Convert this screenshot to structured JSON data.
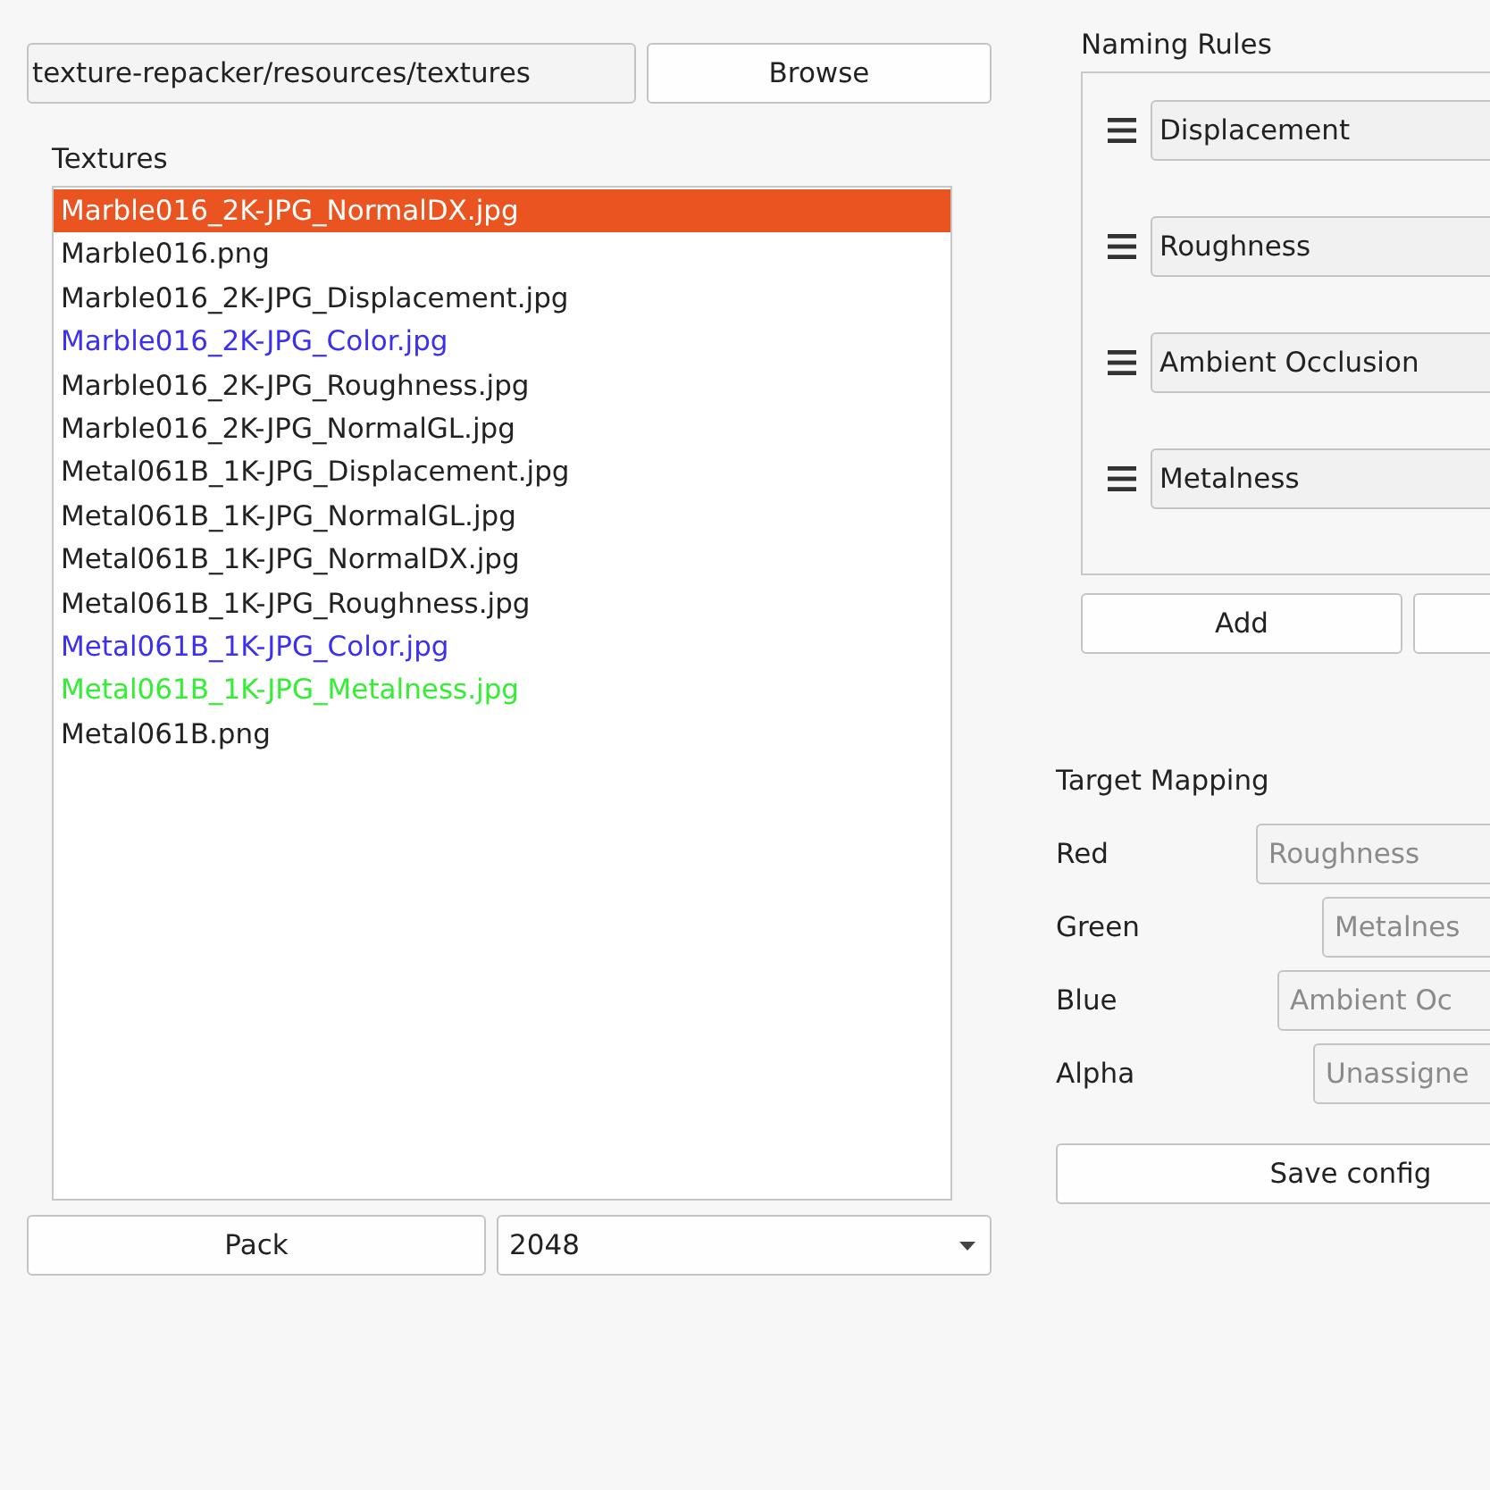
{
  "path_field": {
    "value": "texture-repacker/resources/textures"
  },
  "browse_button": "Browse",
  "textures": {
    "label": "Textures",
    "items": [
      {
        "name": "Marble016_2K-JPG_NormalDX.jpg",
        "selected": true
      },
      {
        "name": "Marble016.png",
        "selected": false,
        "color": "#222222"
      },
      {
        "name": "Marble016_2K-JPG_Displacement.jpg",
        "selected": false,
        "color": "#222222"
      },
      {
        "name": "Marble016_2K-JPG_Color.jpg",
        "selected": false,
        "color": "#3b2ff0"
      },
      {
        "name": "Marble016_2K-JPG_Roughness.jpg",
        "selected": false,
        "color": "#222222"
      },
      {
        "name": "Marble016_2K-JPG_NormalGL.jpg",
        "selected": false,
        "color": "#222222"
      },
      {
        "name": "Metal061B_1K-JPG_Displacement.jpg",
        "selected": false,
        "color": "#222222"
      },
      {
        "name": "Metal061B_1K-JPG_NormalGL.jpg",
        "selected": false,
        "color": "#222222"
      },
      {
        "name": "Metal061B_1K-JPG_NormalDX.jpg",
        "selected": false,
        "color": "#222222"
      },
      {
        "name": "Metal061B_1K-JPG_Roughness.jpg",
        "selected": false,
        "color": "#222222"
      },
      {
        "name": "Metal061B_1K-JPG_Color.jpg",
        "selected": false,
        "color": "#3b2ff0"
      },
      {
        "name": "Metal061B_1K-JPG_Metalness.jpg",
        "selected": false,
        "color": "#33ee33"
      },
      {
        "name": "Metal061B.png",
        "selected": false,
        "color": "#222222"
      }
    ]
  },
  "pack_button": "Pack",
  "size_combo": {
    "value": "2048"
  },
  "naming_rules": {
    "label": "Naming Rules",
    "rules": [
      "Displacement",
      "Roughness",
      "Ambient Occlusion",
      "Metalness"
    ],
    "add_button": "Add"
  },
  "target_mapping": {
    "label": "Target Mapping",
    "channels": [
      {
        "name": "Red",
        "value": "Roughness",
        "disabled": true
      },
      {
        "name": "Green",
        "value": "Metalnes",
        "disabled": true
      },
      {
        "name": "Blue",
        "value": "Ambient Oc",
        "disabled": true
      },
      {
        "name": "Alpha",
        "value": "Unassigne",
        "disabled": true
      }
    ]
  },
  "save_button": "Save config"
}
